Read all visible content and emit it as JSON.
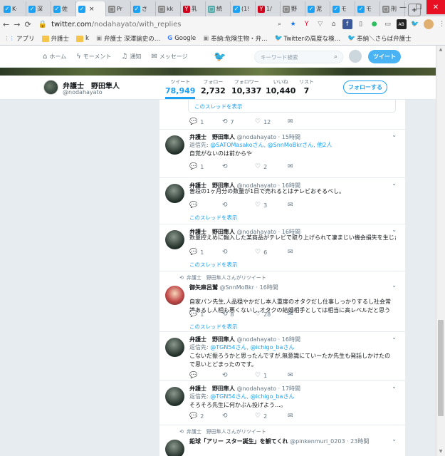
{
  "browser": {
    "tabs": [
      {
        "label": "K·",
        "icon": "twitter-icon",
        "color": "#1da1f2"
      },
      {
        "label": "深",
        "icon": "twitter-icon",
        "color": "#1da1f2"
      },
      {
        "label": "佐",
        "icon": "twitter-icon",
        "color": "#1da1f2"
      },
      {
        "label": "",
        "icon": "twitter-icon",
        "color": "#1da1f2",
        "active": true,
        "close": "×"
      },
      {
        "label": "Pr",
        "icon": "page-icon",
        "color": "#888"
      },
      {
        "label": "さ",
        "icon": "twitter-icon",
        "color": "#1da1f2"
      },
      {
        "label": "kk",
        "icon": "page-icon",
        "color": "#888"
      },
      {
        "label": "乳",
        "icon": "yahoo-icon",
        "color": "#d0021b"
      },
      {
        "label": "続",
        "icon": "page-icon",
        "color": "#5aa"
      },
      {
        "label": "(1!",
        "icon": "twitter-icon",
        "color": "#1da1f2"
      },
      {
        "label": "1/",
        "icon": "yahoo-icon",
        "color": "#d0021b"
      },
      {
        "label": "野",
        "icon": "page-icon",
        "color": "#888"
      },
      {
        "label": "泥",
        "icon": "twitter-icon",
        "color": "#1da1f2"
      },
      {
        "label": "モ",
        "icon": "twitter-icon",
        "color": "#1da1f2"
      },
      {
        "label": "モ",
        "icon": "twitter-icon",
        "color": "#1da1f2"
      },
      {
        "label": "刑",
        "icon": "page-icon",
        "color": "#888"
      }
    ],
    "new_tab": "+",
    "window_controls": {
      "minimize": "—",
      "maximize": "☐",
      "close": "✕"
    },
    "url": {
      "host": "twitter.com",
      "path": "/nodahayato/with_replies"
    },
    "bookmarks": [
      {
        "label": "アプリ",
        "icon": "apps-icon"
      },
      {
        "label": "弁護士",
        "icon": "folder-icon"
      },
      {
        "label": "k",
        "icon": "folder-icon"
      },
      {
        "label": "弁護士 深澤諭史の…",
        "icon": "page-icon"
      },
      {
        "label": "Google",
        "icon": "google-icon"
      },
      {
        "label": "奉納:危険生物・弁…",
        "icon": "page-icon"
      },
      {
        "label": "Twitterの高度な検…",
        "icon": "twitter-icon"
      },
      {
        "label": "奉納＼さらば弁護士",
        "icon": "twitter-icon"
      }
    ]
  },
  "twitter_nav": {
    "home": "ホーム",
    "moments": "モーメント",
    "notifications": "通知",
    "messages": "メッセージ",
    "search_placeholder": "キーワード検索",
    "tweet_button": "ツイート"
  },
  "profile": {
    "name": "弁護士　野田隼人",
    "handle": "@nodahayato",
    "stats": [
      {
        "label": "ツイート",
        "value": "78,949",
        "active": true
      },
      {
        "label": "フォロー",
        "value": "2,732"
      },
      {
        "label": "フォロワー",
        "value": "10,337"
      },
      {
        "label": "いいね",
        "value": "10,440"
      },
      {
        "label": "リスト",
        "value": "7"
      }
    ],
    "follow_button": "フォローする"
  },
  "timeline": {
    "top_quote_link": "このスレッドを表示",
    "top_actions": {
      "reply": "1",
      "retweet": "7",
      "like": "12"
    },
    "tweets": [
      {
        "name": "弁護士　野田隼人",
        "handle": "@nodahayato · 15時間",
        "reply_prefix": "返信先: ",
        "reply_mentions": "@SATOMasakoさん, @SnnMoBkrさん, 他2人",
        "text": "自覚がないのは前からや",
        "actions": {
          "reply": "1",
          "retweet": "",
          "like": "2"
        },
        "thread_link": ""
      },
      {
        "name": "弁護士　野田隼人",
        "handle": "@nodahayato · 16時間",
        "text": "普段の1ヶ月分の数量が1日で売れるとはテレビおそるべし。",
        "actions": {
          "reply": "",
          "retweet": "",
          "like": "3"
        },
        "thread_link": "このスレッドを表示"
      },
      {
        "name": "弁護士　野田隼人",
        "handle": "@nodahayato · 16時間",
        "text": "数量控えめに輸入した某商品がテレビで取り上げられて凄まじい機会損失を生じた…。",
        "actions": {
          "reply": "1",
          "retweet": "",
          "like": "6"
        },
        "thread_link": "このスレッドを表示"
      },
      {
        "retweet_context": "弁護士　野田隼人さんがリツイート",
        "name": "御矢麻呂鷲",
        "handle": "@SnnMoBkr · 16時間",
        "text": "自家パン先生,人品穏やかだし本人重度のオタクだし仕事しっかりするし社会常識あるし人相も悪くないし,オタクの結婚相手としては相当に高レベルだと思う",
        "actions": {
          "reply": "1",
          "retweet": "8",
          "like": "28"
        },
        "thread_link": "このスレッドを表示"
      },
      {
        "name": "弁護士　野田隼人",
        "handle": "@nodahayato · 16時間",
        "reply_prefix": "返信先: ",
        "reply_mentions": "@TGN54さん, @ichigo_baさん",
        "text": "こないだ振ろうかと思ったんですが,無意識にていーたか先生も発話しかけたので思いとどまったのです。",
        "actions": {
          "reply": "",
          "retweet": "",
          "like": "1"
        },
        "thread_link": ""
      },
      {
        "name": "弁護士　野田隼人",
        "handle": "@nodahayato · 17時間",
        "reply_prefix": "返信先: ",
        "reply_mentions": "@TGN54さん, @ichigo_baさん",
        "text": "そろそろ先生に何かぶん投げよう…。",
        "actions": {
          "reply": "2",
          "retweet": "",
          "like": "2"
        },
        "thread_link": ""
      },
      {
        "retweet_context": "弁護士　野田隼人さんがリツイート",
        "name": "鉛球「アリー スター誕生」を観てくれ",
        "handle": "@pinkenmuri_0203 · 23時間",
        "text": "",
        "actions": {
          "reply": "",
          "retweet": "",
          "like": ""
        },
        "thread_link": ""
      }
    ]
  }
}
